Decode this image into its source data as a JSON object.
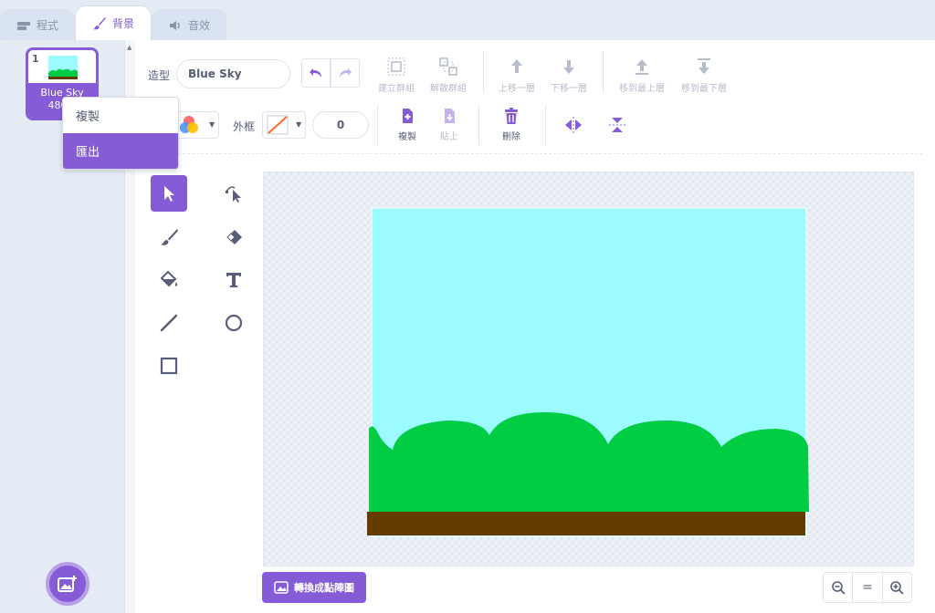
{
  "tabs": [
    {
      "label": "程式",
      "icon": "code-icon"
    },
    {
      "label": "背景",
      "icon": "paintbrush-icon"
    },
    {
      "label": "音效",
      "icon": "sound-icon"
    }
  ],
  "costume": {
    "number": "1",
    "name": "Blue Sky",
    "size_prefix": "480 x"
  },
  "context_menu": {
    "items": [
      "複製",
      "匯出"
    ],
    "highlighted": "匯出"
  },
  "toolbar": {
    "costume_label": "造型",
    "costume_name": "Blue Sky",
    "group_label": "建立群組",
    "ungroup_label": "解散群組",
    "forward_label": "上移一層",
    "backward_label": "下移一層",
    "front_label": "移到最上層",
    "back_label": "移到最下層",
    "outline_label": "外框",
    "outline_width": "0",
    "copy_label": "複製",
    "paste_label": "貼上",
    "delete_label": "刪除"
  },
  "bottom": {
    "convert_label": "轉換成點陣圖",
    "zoom_reset": "="
  },
  "colors": {
    "accent": "#855cd6",
    "sky": "#9bfbfe",
    "grass": "#00cc44",
    "ground": "#653c00"
  }
}
